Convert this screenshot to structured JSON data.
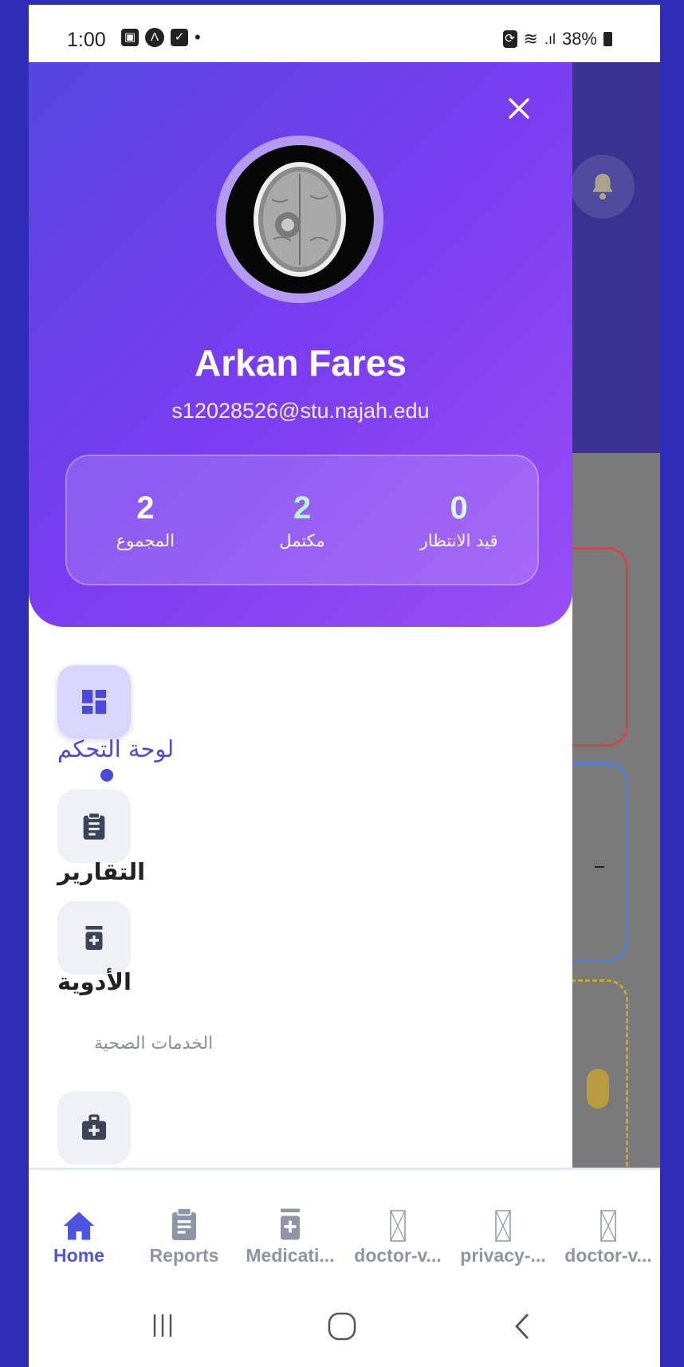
{
  "status_bar": {
    "time": "1:00",
    "battery": "38%"
  },
  "drawer": {
    "user": {
      "name": "Arkan Fares",
      "email": "s12028526@stu.najah.edu"
    },
    "stats": [
      {
        "value": "2",
        "label": "المجموع"
      },
      {
        "value": "2",
        "label": "مكتمل"
      },
      {
        "value": "0",
        "label": "قيد الانتظار"
      }
    ],
    "menu": {
      "dashboard": "لوحة التحكم",
      "reports": "التقارير",
      "medications": "الأدوية",
      "section_health_services": "الخدمات الصحية"
    }
  },
  "bottom_nav": [
    {
      "label": "Home",
      "icon": "home-icon",
      "active": true
    },
    {
      "label": "Reports",
      "icon": "clipboard-icon",
      "active": false
    },
    {
      "label": "Medicati...",
      "icon": "medication-icon",
      "active": false
    },
    {
      "label": "doctor-v...",
      "icon": "broken-image-icon",
      "active": false
    },
    {
      "label": "privacy-...",
      "icon": "broken-image-icon",
      "active": false
    },
    {
      "label": "doctor-v...",
      "icon": "broken-image-icon",
      "active": false
    }
  ],
  "colors": {
    "accent": "#4b49d8",
    "header_start": "#5545e0",
    "header_end": "#9a4ef5",
    "outer_bg": "#2e2db8"
  }
}
